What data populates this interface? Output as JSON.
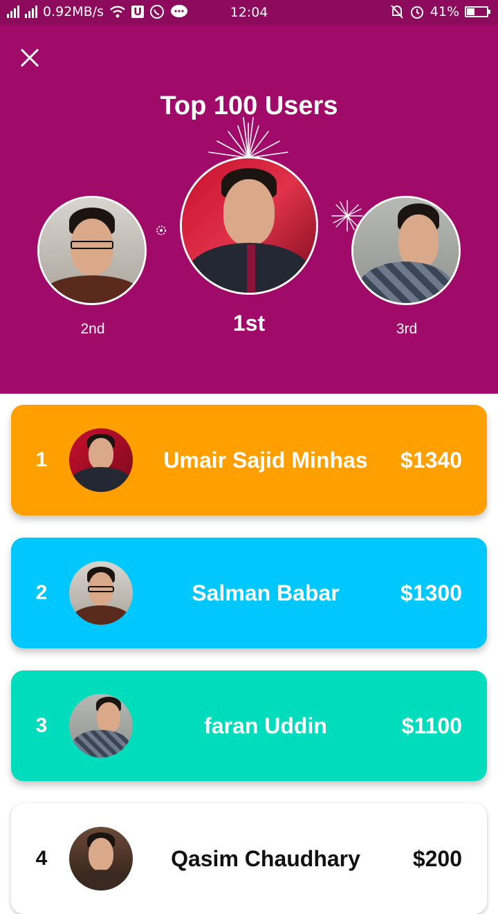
{
  "status_bar": {
    "speed": "0.92MB/s",
    "time": "12:04",
    "battery": "41%",
    "battery_level": 0.41,
    "icons": [
      "signal-icon",
      "signal-icon",
      "wifi-icon",
      "u-app-icon",
      "whatsapp-icon",
      "message-icon",
      "bell-muted-icon",
      "alarm-icon",
      "battery-icon"
    ]
  },
  "header": {
    "title": "Top 100 Users",
    "close_icon": "close-icon"
  },
  "podium": [
    {
      "place": "2nd",
      "user": "Salman Babar"
    },
    {
      "place": "1st",
      "user": "Umair Sajid Minhas"
    },
    {
      "place": "3rd",
      "user": "faran Uddin"
    }
  ],
  "leaderboard": [
    {
      "rank": "1",
      "name": "Umair Sajid Minhas",
      "amount": "$1340",
      "color": "#ff9f00"
    },
    {
      "rank": "2",
      "name": "Salman Babar",
      "amount": "$1300",
      "color": "#00c8ff"
    },
    {
      "rank": "3",
      "name": "faran Uddin",
      "amount": "$1100",
      "color": "#00dcbc"
    },
    {
      "rank": "4",
      "name": "Qasim Chaudhary",
      "amount": "$200",
      "color": "#ffffff"
    }
  ],
  "colors": {
    "header_bg": "#a00a68",
    "status_bg": "#8c0b5d"
  }
}
